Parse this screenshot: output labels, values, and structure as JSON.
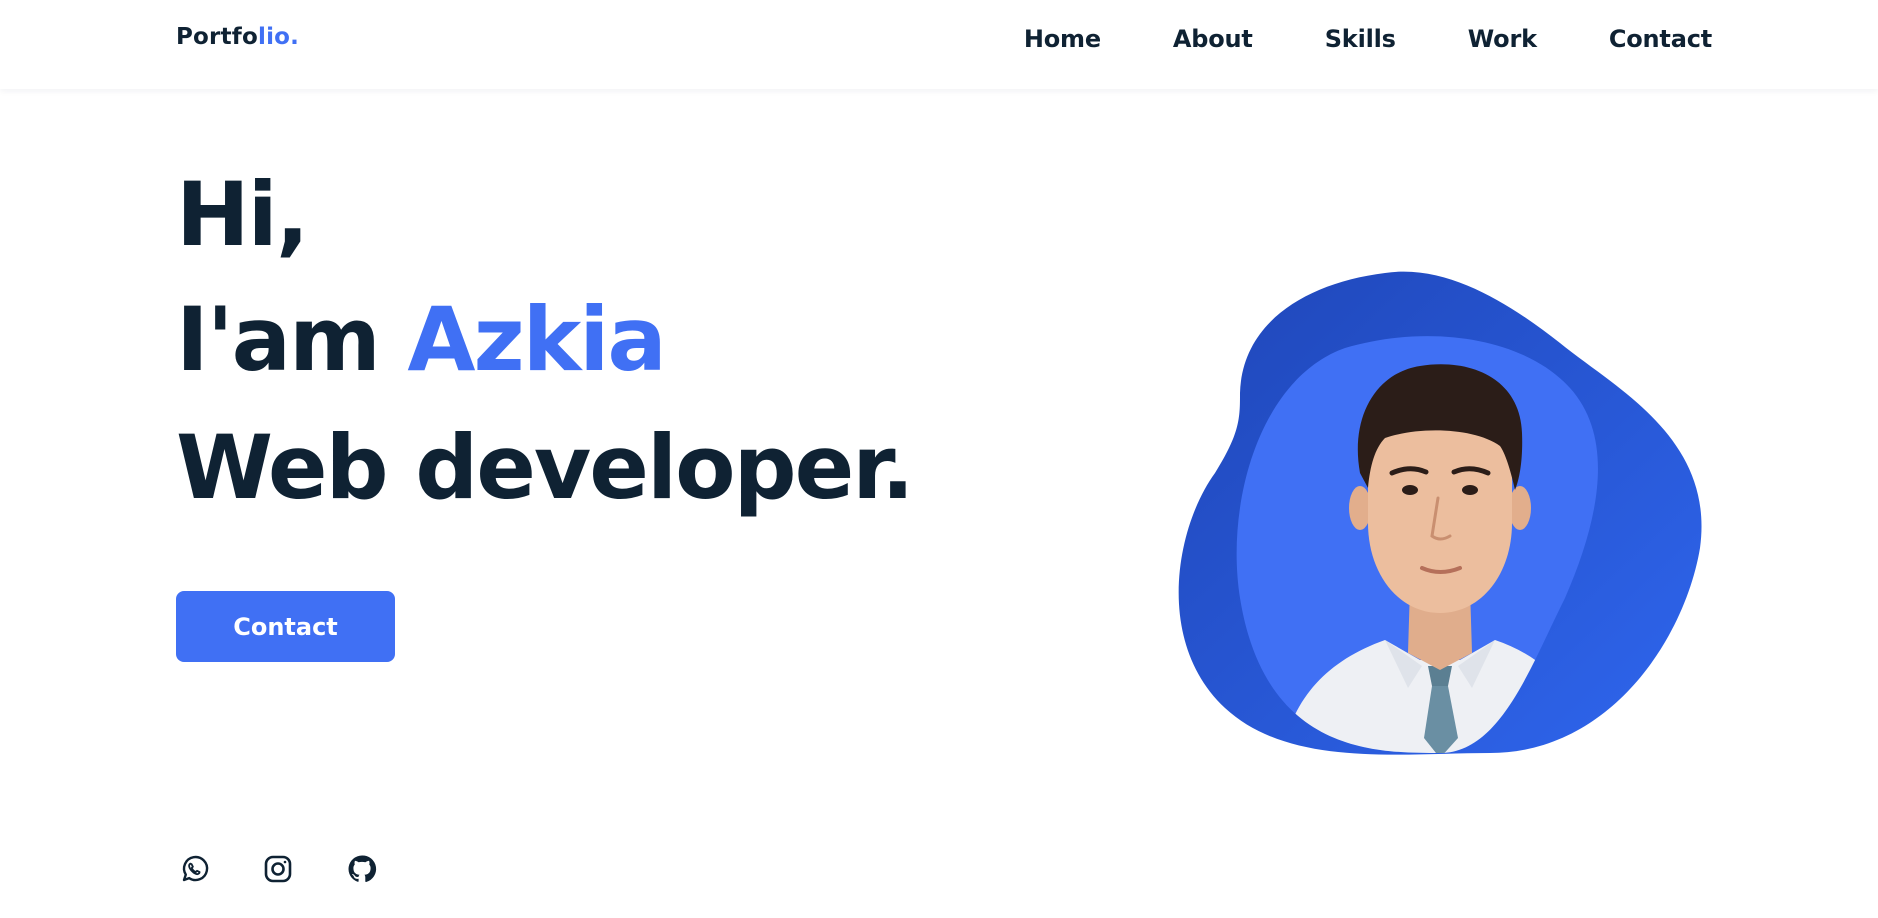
{
  "header": {
    "logo_main": "Portfo",
    "logo_accent": "lio.",
    "nav": [
      {
        "label": "Home"
      },
      {
        "label": "About"
      },
      {
        "label": "Skills"
      },
      {
        "label": "Work"
      },
      {
        "label": "Contact"
      }
    ]
  },
  "hero": {
    "greeting": "Hi,",
    "intro_prefix": "I'am ",
    "name": "Azkia",
    "role": "Web developer.",
    "cta_label": "Contact",
    "profile_photo_alt": "profile-photo"
  },
  "socials": [
    {
      "icon": "whatsapp-icon"
    },
    {
      "icon": "instagram-icon"
    },
    {
      "icon": "github-icon"
    }
  ],
  "colors": {
    "accent": "#4070f4",
    "text": "#0f2233",
    "blob_dark": "#2450d6",
    "blob_light": "#4070f4"
  }
}
